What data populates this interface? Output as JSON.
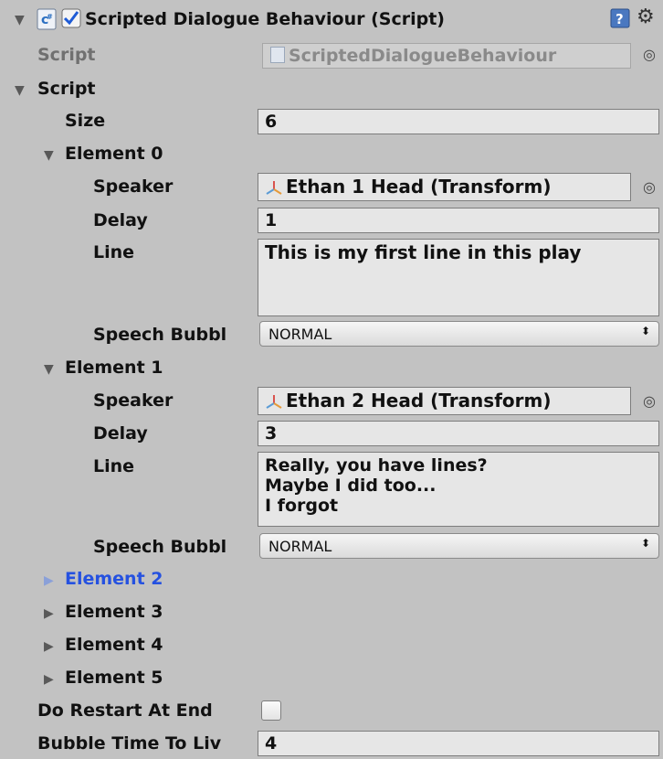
{
  "component": {
    "title": "Scripted Dialogue Behaviour (Script)",
    "enabled": true,
    "script_label": "Script",
    "script_value": "ScriptedDialogueBehaviour"
  },
  "script_list": {
    "label": "Script",
    "size_label": "Size",
    "size_value": "6",
    "elements": [
      {
        "label": "Element 0",
        "speaker_label": "Speaker",
        "speaker_value": "Ethan 1 Head (Transform)",
        "delay_label": "Delay",
        "delay_value": "1",
        "line_label": "Line",
        "line_value": "This is my first line in this play",
        "bubble_label": "Speech Bubbl",
        "bubble_value": "NORMAL"
      },
      {
        "label": "Element 1",
        "speaker_label": "Speaker",
        "speaker_value": "Ethan 2 Head (Transform)",
        "delay_label": "Delay",
        "delay_value": "3",
        "line_label": "Line",
        "line_value": "Really, you have lines?\nMaybe I did too...\nI forgot",
        "bubble_label": "Speech Bubbl",
        "bubble_value": "NORMAL"
      }
    ],
    "collapsed": [
      "Element 2",
      "Element 3",
      "Element 4",
      "Element 5"
    ]
  },
  "restart": {
    "label": "Do Restart At End",
    "checked": false
  },
  "bubble_time": {
    "label": "Bubble Time To Liv",
    "value": "4"
  },
  "colors": {
    "background": "#c2c2c2",
    "field": "#e6e6e6",
    "selected_text": "#2551e0",
    "check_blue": "#1e5bd6"
  },
  "icons": [
    "foldout-arrow-icon",
    "script-icon",
    "checkbox-check-icon",
    "help-icon",
    "gear-icon",
    "object-picker-icon",
    "transform-icon",
    "dropdown-arrows-icon"
  ]
}
